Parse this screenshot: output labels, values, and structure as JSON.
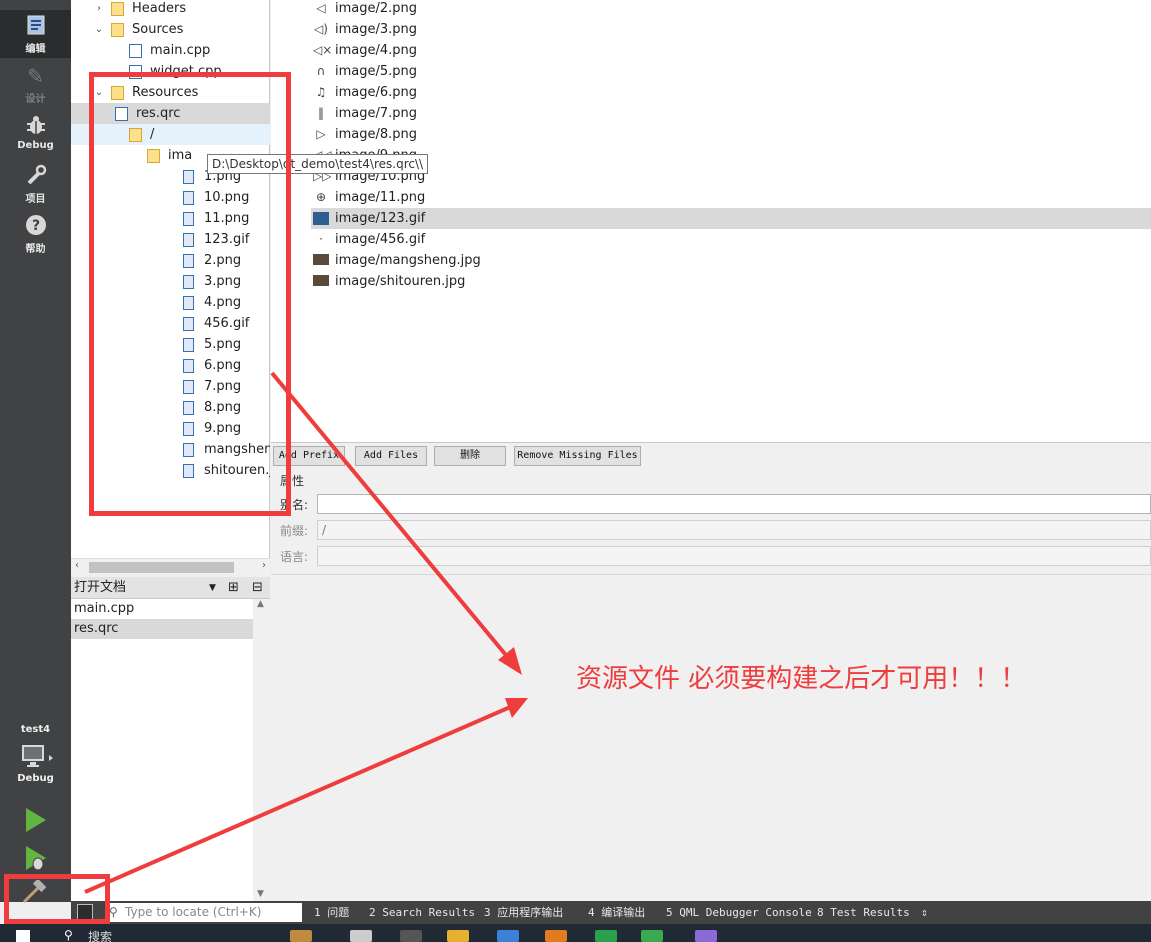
{
  "modebar": {
    "modes": [
      {
        "label": "编辑",
        "icon": "edit-doc-icon",
        "active": true
      },
      {
        "label": "设计",
        "icon": "pencil-icon",
        "disabled": true
      },
      {
        "label": "Debug",
        "icon": "bug-icon"
      },
      {
        "label": "项目",
        "icon": "wrench-icon"
      },
      {
        "label": "帮助",
        "icon": "help-icon"
      }
    ],
    "kit_name": "test4",
    "kit_mode": "Debug"
  },
  "project_tree": {
    "nodes": [
      {
        "label": "Headers",
        "arrow": ">",
        "icon": "header-folder"
      },
      {
        "label": "Sources",
        "arrow": "v",
        "icon": "source-folder"
      },
      {
        "label": "main.cpp",
        "icon": "cpp-file"
      },
      {
        "label": "widget.cpp",
        "icon": "cpp-file"
      },
      {
        "label": "Resources",
        "arrow": "v",
        "icon": "resource-folder"
      },
      {
        "label": "res.qrc",
        "arrow": "v",
        "icon": "qrc-file"
      },
      {
        "label": "/",
        "arrow": "v",
        "icon": "folder"
      },
      {
        "label": "ima",
        "arrow": "v",
        "icon": "folder"
      },
      {
        "label": "1.png",
        "icon": "image-file"
      },
      {
        "label": "10.png",
        "icon": "image-file"
      },
      {
        "label": "11.png",
        "icon": "image-file"
      },
      {
        "label": "123.gif",
        "icon": "image-file"
      },
      {
        "label": "2.png",
        "icon": "image-file"
      },
      {
        "label": "3.png",
        "icon": "image-file"
      },
      {
        "label": "4.png",
        "icon": "image-file"
      },
      {
        "label": "456.gif",
        "icon": "image-file"
      },
      {
        "label": "5.png",
        "icon": "image-file"
      },
      {
        "label": "6.png",
        "icon": "image-file"
      },
      {
        "label": "7.png",
        "icon": "image-file"
      },
      {
        "label": "8.png",
        "icon": "image-file"
      },
      {
        "label": "9.png",
        "icon": "image-file"
      },
      {
        "label": "mangsheng.jpg",
        "icon": "image-file"
      },
      {
        "label": "shitouren.jpg",
        "icon": "image-file"
      }
    ]
  },
  "tooltip": "D:\\Desktop\\qt_demo\\test4\\res.qrc\\\\",
  "open_docs": {
    "title": "打开文档",
    "items": [
      "main.cpp",
      "res.qrc"
    ]
  },
  "resource_files": [
    {
      "name": "image/2.png",
      "thumb": "speaker-icon"
    },
    {
      "name": "image/3.png",
      "thumb": "volume-icon"
    },
    {
      "name": "image/4.png",
      "thumb": "mute-icon"
    },
    {
      "name": "image/5.png",
      "thumb": "headphones-icon"
    },
    {
      "name": "image/6.png",
      "thumb": "music-note-icon"
    },
    {
      "name": "image/7.png",
      "thumb": "bar-icon"
    },
    {
      "name": "image/8.png",
      "thumb": "play-icon"
    },
    {
      "name": "image/9.png",
      "thumb": "rewind-icon"
    },
    {
      "name": "image/10.png",
      "thumb": "forward-icon"
    },
    {
      "name": "image/11.png",
      "thumb": "zoom-icon"
    },
    {
      "name": "image/123.gif",
      "thumb": "gif-thumbnail"
    },
    {
      "name": "image/456.gif",
      "thumb": "dot-icon"
    },
    {
      "name": "image/mangsheng.jpg",
      "thumb": "photo-thumbnail"
    },
    {
      "name": "image/shitouren.jpg",
      "thumb": "photo-thumbnail"
    }
  ],
  "buttons": {
    "add_prefix": "Add Prefix",
    "add_files": "Add Files",
    "delete": "删除",
    "remove_missing": "Remove Missing Files"
  },
  "properties": {
    "section": "属性",
    "alias_label": "别名:",
    "alias_value": "",
    "prefix_label": "前缀:",
    "prefix_value": "/",
    "lang_label": "语言:",
    "lang_value": ""
  },
  "annotation": "资源文件 必须要构建之后才可用！！！",
  "outbar": {
    "locator_placeholder": "Type to locate (Ctrl+K)",
    "tabs": [
      "1 问题",
      "2 Search Results",
      "3 应用程序输出",
      "4 编译输出",
      "5 QML Debugger Console",
      "8 Test Results"
    ]
  },
  "taskbar": {
    "search": "搜索"
  },
  "colors": {
    "modebar": "#404244",
    "annotation_red": "#ef3c3c",
    "selection": "#d9d9d9"
  }
}
